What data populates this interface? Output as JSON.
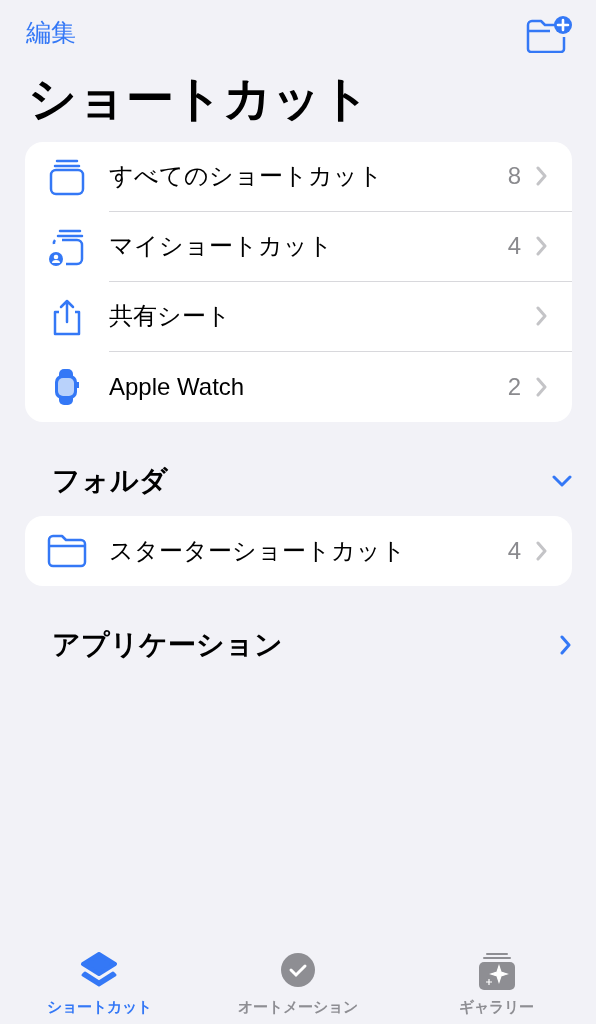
{
  "nav": {
    "edit": "編集"
  },
  "title": "ショートカット",
  "library": [
    {
      "label": "すべてのショートカット",
      "count": "8"
    },
    {
      "label": "マイショートカット",
      "count": "4"
    },
    {
      "label": "共有シート"
    },
    {
      "label": "Apple Watch",
      "count": "2"
    }
  ],
  "sections": [
    {
      "title": "フォルダ",
      "expanded": true,
      "items": [
        {
          "label": "スターターショートカット",
          "count": "4"
        }
      ]
    },
    {
      "title": "アプリケーション",
      "expanded": false
    }
  ],
  "tabs": [
    {
      "label": "ショートカット",
      "selected": true
    },
    {
      "label": "オートメーション",
      "selected": false
    },
    {
      "label": "ギャラリー",
      "selected": false
    }
  ]
}
